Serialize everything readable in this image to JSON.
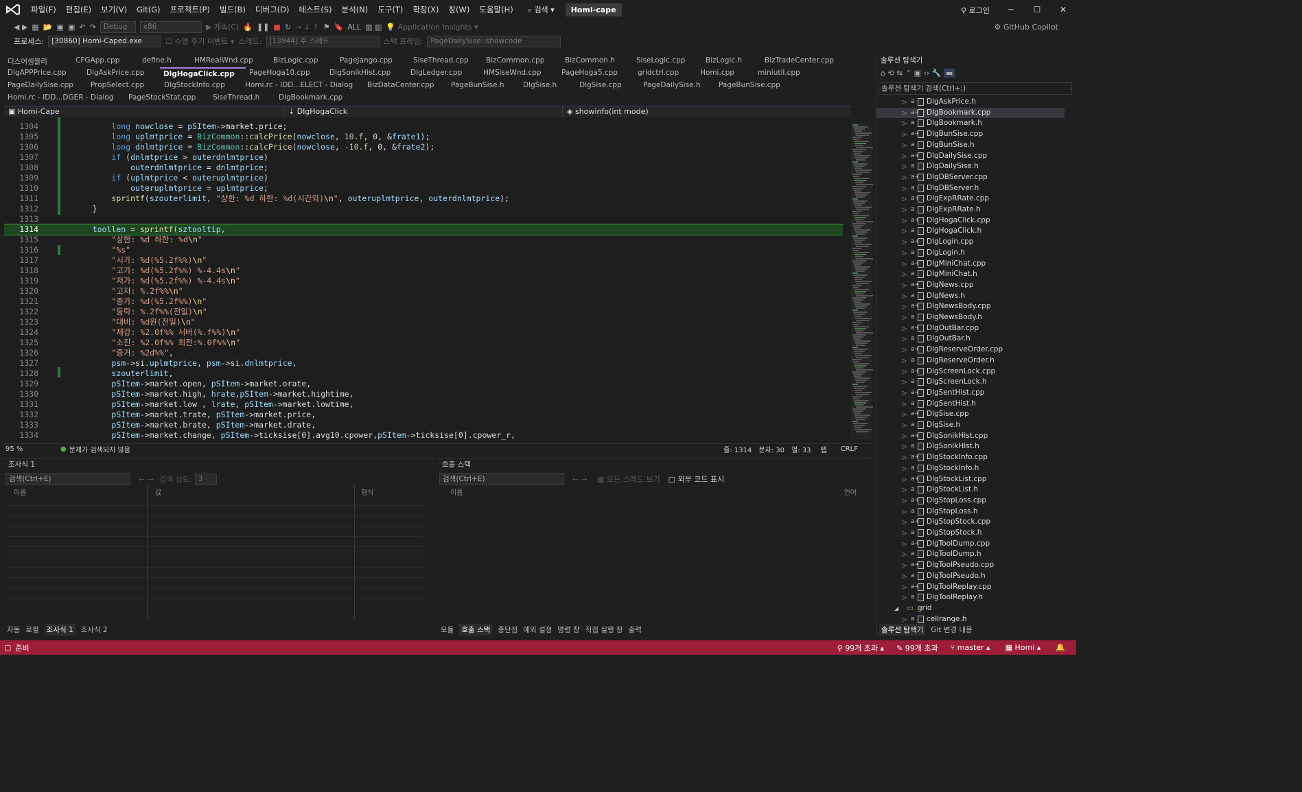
{
  "title": {
    "project": "Homi-cape",
    "search": "검색",
    "login": "로그인",
    "copilot": "GitHub Copilot",
    "menu": [
      "파일(F)",
      "편집(E)",
      "보기(V)",
      "Git(G)",
      "프로젝트(P)",
      "빌드(B)",
      "디버그(D)",
      "테스트(S)",
      "분석(N)",
      "도구(T)",
      "확장(X)",
      "창(W)",
      "도움말(H)"
    ]
  },
  "toolbar": {
    "config": "Debug",
    "platform": "x86",
    "continue": "계속(C)",
    "all": "ALL",
    "insights": "Application Insights",
    "process_label": "프로세스:",
    "process": "[30860] Homi-Caped.exe",
    "lifecycle": "수명 주기 이벤트",
    "thread_label": "스레드:",
    "thread": "[13944] 주 스레드",
    "stackframe_label": "스택 프레임:",
    "stackframe": "PageDailySise::showcode"
  },
  "tabs": [
    [
      "디스어셈블리",
      "CFGApp.cpp",
      "define.h",
      "HMRealWnd.cpp",
      "BizLogic.cpp",
      "PageJango.cpp",
      "SiseThread.cpp",
      "BizCommon.cpp",
      "BizCommon.h",
      "SiseLogic.cpp",
      "BizLogic.h",
      "BizTradeCenter.cpp"
    ],
    [
      "DlgAPPPrice.cpp",
      "DlgAskPrice.cpp",
      "DlgHogaClick.cpp",
      "PageHoga10.cpp",
      "DlgSonikHist.cpp",
      "DlgLedger.cpp",
      "HMSiseWnd.cpp",
      "PageHoga5.cpp",
      "gridctrl.cpp",
      "Homi.cpp",
      "miniutil.cpp"
    ],
    [
      "PageDailySise.cpp",
      "PropSelect.cpp",
      "DlgStockInfo.cpp",
      "Homi.rc - IDD...ELECT - Dialog",
      "BizDataCenter.cpp",
      "PageBunSise.h",
      "DlgSise.h",
      "DlgSise.cpp",
      "PageDailySise.h",
      "PageBunSise.cpp"
    ],
    [
      "Homi.rc - IDD...DGER - Dialog",
      "PageStockStat.cpp",
      "SiseThread.h",
      "DlgBookmark.cpp"
    ]
  ],
  "nav": {
    "project": "Homi-Cape",
    "class": "DlgHogaClick",
    "method": "showinfo(int mode)"
  },
  "code": [
    {
      "n": "1304",
      "t": "        long nowclose = pSItem->market.price;"
    },
    {
      "n": "1305",
      "t": "        long uplmtprice = BizCommon::calcPrice(nowclose, 10.f, 0, &frate1);"
    },
    {
      "n": "1306",
      "t": "        long dnlmtprice = BizCommon::calcPrice(nowclose, -10.f, 0, &frate2);"
    },
    {
      "n": "1307",
      "t": "        if (dnlmtprice > outerdnlmtprice)"
    },
    {
      "n": "1308",
      "t": "            outerdnlmtprice = dnlmtprice;"
    },
    {
      "n": "1309",
      "t": "        if (uplmtprice < outeruplmtprice)"
    },
    {
      "n": "1310",
      "t": "            outeruplmtprice = uplmtprice;"
    },
    {
      "n": "1311",
      "t": "        sprintf(szouterlimit, \"상한: %d 하한: %d(시간외)\\n\", outeruplmtprice, outerdnlmtprice);"
    },
    {
      "n": "1312",
      "t": "    }"
    },
    {
      "n": "1313",
      "t": ""
    },
    {
      "n": "1314",
      "t": "    toollen = sprintf(sztooltip,"
    },
    {
      "n": "1315",
      "t": "        \"상한: %d 하한: %d\\n\""
    },
    {
      "n": "1316",
      "t": "        \"%s\""
    },
    {
      "n": "1317",
      "t": "        \"시가: %d(%5.2f%%)\\n\""
    },
    {
      "n": "1318",
      "t": "        \"고가: %d(%5.2f%%) %-4.4s\\n\""
    },
    {
      "n": "1319",
      "t": "        \"저가: %d(%5.2f%%) %-4.4s\\n\""
    },
    {
      "n": "1320",
      "t": "        \"고저: %.2f%%\\n\""
    },
    {
      "n": "1321",
      "t": "        \"종가: %d(%5.2f%%)\\n\""
    },
    {
      "n": "1322",
      "t": "        \"등락: %.2f%%(전일)\\n\""
    },
    {
      "n": "1323",
      "t": "        \"대비: %d원(전일)\\n\""
    },
    {
      "n": "1324",
      "t": "        \"체강: %2.0f%% 서버(%.f%%)\\n\""
    },
    {
      "n": "1325",
      "t": "        \"소진: %2.0f%% 회전:%.0f%%\\n\""
    },
    {
      "n": "1326",
      "t": "        \"증거: %2d%%\","
    },
    {
      "n": "1327",
      "t": "        psm->si.uplmtprice, psm->si.dnlmtprice,"
    },
    {
      "n": "1328",
      "t": "        szouterlimit,"
    },
    {
      "n": "1329",
      "t": "        pSItem->market.open, pSItem->market.orate,"
    },
    {
      "n": "1330",
      "t": "        pSItem->market.high, hrate,pSItem->market.hightime,"
    },
    {
      "n": "1331",
      "t": "        pSItem->market.low , lrate, pSItem->market.lowtime,"
    },
    {
      "n": "1332",
      "t": "        pSItem->market.trate, pSItem->market.price,"
    },
    {
      "n": "1333",
      "t": "        pSItem->market.brate, pSItem->market.drate,"
    },
    {
      "n": "1334",
      "t": "        pSItem->market.change, pSItem->ticksise[0].avg10.cpower,pSItem->ticksise[0].cpower_r,"
    }
  ],
  "editor_status": {
    "zoom": "95 %",
    "issues": "문제가 검색되지 않음",
    "line": "줄: 1314",
    "char": "문자: 30",
    "col": "열: 33",
    "tab": "탭",
    "eol": "CRLF"
  },
  "watch": {
    "title": "조사식 1",
    "search": "검색(Ctrl+E)",
    "depth_label": "검색 심도:",
    "depth": "3",
    "cols": [
      "이름",
      "값",
      "형식"
    ],
    "tabs": [
      "자동",
      "로컬",
      "조사식 1",
      "조사식 2"
    ]
  },
  "callstack": {
    "title": "호출 스택",
    "search": "검색(Ctrl+E)",
    "show_threads": "모든 스레드 보기",
    "external": "외부 코드 표시",
    "cols": [
      "이름",
      "언어"
    ],
    "tabs": [
      "모듈",
      "호출 스택",
      "중단점",
      "예외 설정",
      "명령 창",
      "직접 실행 창",
      "출력"
    ]
  },
  "solution": {
    "title": "솔루션 탐색기",
    "search": "솔루션 탐색기 검색(Ctrl+;)",
    "tabs": [
      "솔루션 탐색기",
      "Git 변경 내용"
    ],
    "items": [
      "DlgAskPrice.h",
      "DlgBookmark.cpp",
      "DlgBookmark.h",
      "DlgBunSise.cpp",
      "DlgBunSise.h",
      "DlgDailySise.cpp",
      "DlgDailySise.h",
      "DlgDBServer.cpp",
      "DlgDBServer.h",
      "DlgExpRRate.cpp",
      "DlgExpRRate.h",
      "DlgHogaClick.cpp",
      "DlgHogaClick.h",
      "DlgLogin.cpp",
      "DlgLogin.h",
      "DlgMiniChat.cpp",
      "DlgMiniChat.h",
      "DlgNews.cpp",
      "DlgNews.h",
      "DlgNewsBody.cpp",
      "DlgNewsBody.h",
      "DlgOutBar.cpp",
      "DlgOutBar.h",
      "DlgReserveOrder.cpp",
      "DlgReserveOrder.h",
      "DlgScreenLock.cpp",
      "DlgScreenLock.h",
      "DlgSentHist.cpp",
      "DlgSentHist.h",
      "DlgSise.cpp",
      "DlgSise.h",
      "DlgSonikHist.cpp",
      "DlgSonikHist.h",
      "DlgStockInfo.cpp",
      "DlgStockInfo.h",
      "DlgStockList.cpp",
      "DlgStockList.h",
      "DlgStopLoss.cpp",
      "DlgStopLoss.h",
      "DlgStopStock.cpp",
      "DlgStopStock.h",
      "DlgToolDump.cpp",
      "DlgToolDump.h",
      "DlgToolPseudo.cpp",
      "DlgToolPseudo.h",
      "DlgToolReplay.cpp",
      "DlgToolReplay.h"
    ],
    "folder": "grid",
    "last": "cellrange.h"
  },
  "statusbar": {
    "ready": "준비",
    "errors": "99개 초과",
    "changes": "99개 초과",
    "branch": "master",
    "repo": "Homi"
  },
  "colors": {
    "accent": "#a47ee0",
    "status": "#9e1e3a",
    "highlight": "#1e4620"
  }
}
